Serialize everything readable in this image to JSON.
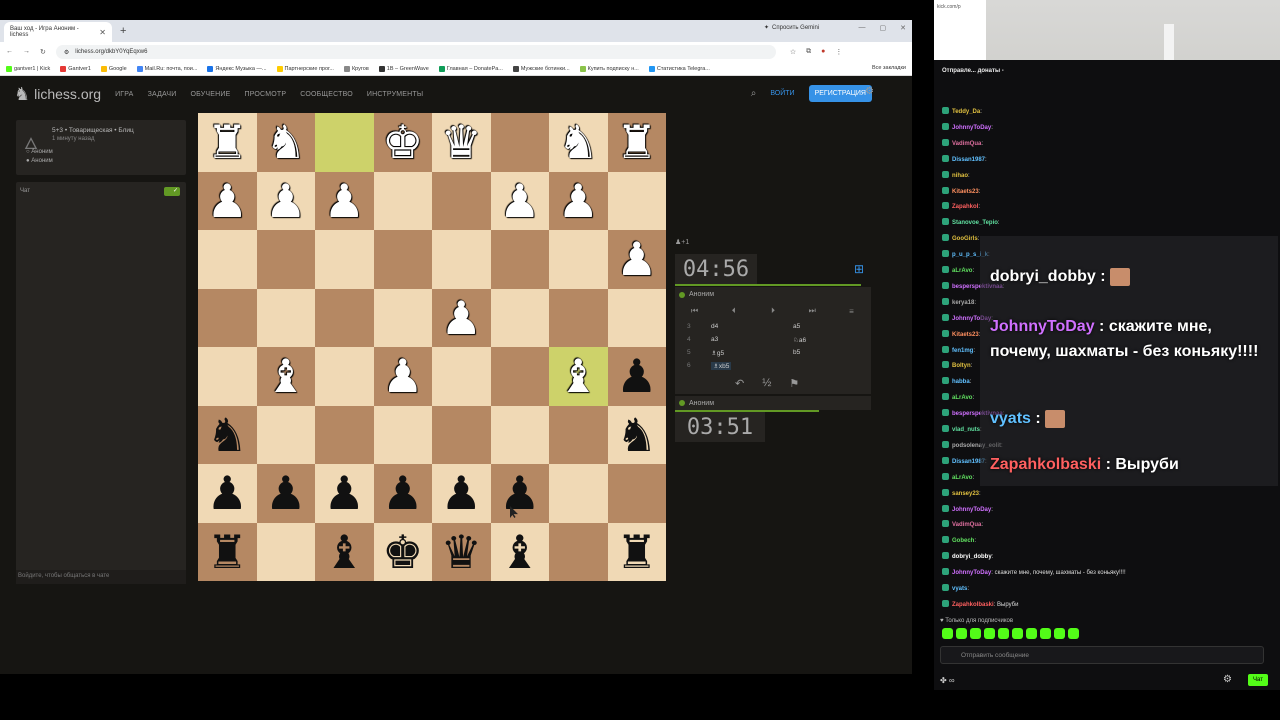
{
  "browser": {
    "tab_title": "Ваш ход - Игра Аноним - lichess",
    "gemini_label": "Спросить Gemini",
    "url": "lichess.org/dkbY0YqEqxw6",
    "bookmarks": [
      "gantver1 | Kick",
      "Gantver1",
      "Google",
      "Mail.Ru: почта, пои...",
      "Яндекс Музыка —...",
      "Партнерские прог...",
      "Кругов",
      "1B – GreenWave",
      "Главная – DonatePa...",
      "Мужские ботинки...",
      "Купить подписку н...",
      "Статистика Telegra..."
    ],
    "bookmarks_all": "Все закладки"
  },
  "lichess": {
    "logo": "lichess.org",
    "nav": [
      "ИГРА",
      "ЗАДАЧИ",
      "ОБУЧЕНИЕ",
      "ПРОСМОТР",
      "СООБЩЕСТВО",
      "ИНСТРУМЕНТЫ"
    ],
    "login": "ВОЙТИ",
    "register": "РЕГИСТРАЦИЯ"
  },
  "game": {
    "title": "5+3 • Товарищеская • Блиц",
    "time_ago": "1 минуту назад",
    "player1": "Аноним",
    "player2": "Аноним",
    "chat_label": "Чат",
    "chat_footer": "Войдите, чтобы общаться в чате"
  },
  "board": {
    "rows": [
      [
        "wR",
        "wN",
        "",
        "wK",
        "wQ",
        "",
        "wN",
        "wR"
      ],
      [
        "wP",
        "wP",
        "wP",
        "",
        "",
        "wP",
        "wP",
        ""
      ],
      [
        "",
        "",
        "",
        "",
        "",
        "",
        "",
        "wP"
      ],
      [
        "",
        "",
        "",
        "",
        "wP",
        "",
        "",
        ""
      ],
      [
        "",
        "wB",
        "",
        "wP",
        "",
        "",
        "wB",
        "bP"
      ],
      [
        "bN",
        "",
        "",
        "",
        "",
        "",
        "",
        "bN"
      ],
      [
        "bP",
        "bP",
        "bP",
        "bP",
        "bP",
        "bP",
        "",
        ""
      ],
      [
        "bR",
        "",
        "bB",
        "bK",
        "bQ",
        "bB",
        "",
        "bR"
      ]
    ],
    "highlights": [
      "0-2",
      "4-6"
    ]
  },
  "clock": {
    "provisional": "+1",
    "top_time": "04:56",
    "top_player": "Аноним",
    "bottom_time": "03:51",
    "bottom_player": "Аноним"
  },
  "moves": [
    {
      "num": "3",
      "white": "d4",
      "black": "a5"
    },
    {
      "num": "4",
      "white": "a3",
      "black": "♘a6"
    },
    {
      "num": "5",
      "white": "♗g5",
      "black": "b5"
    },
    {
      "num": "6",
      "white": "♗xb5",
      "black": ""
    }
  ],
  "stream_chat": {
    "lines": [
      {
        "name": "Teddy_Da",
        "text": "",
        "color": "#e0c040"
      },
      {
        "name": "JohnnyToDay",
        "text": "",
        "color": "#d070ff"
      },
      {
        "name": "VadimQua",
        "text": "",
        "color": "#e070a0"
      },
      {
        "name": "Dissan1987",
        "text": "",
        "color": "#60c0ff"
      },
      {
        "name": "nihao",
        "text": "",
        "color": "#e0c040"
      },
      {
        "name": "Kitaets23",
        "text": "",
        "color": "#ff9060"
      },
      {
        "name": "Zapahkol",
        "text": "",
        "color": "#ff6060"
      },
      {
        "name": "Stanovoe_Tepio",
        "text": "",
        "color": "#60e0a0"
      },
      {
        "name": "GooGirls",
        "text": "",
        "color": "#e0c040"
      },
      {
        "name": "p_u_p_s_i_k",
        "text": "",
        "color": "#60c0ff"
      },
      {
        "name": "aLrAvo",
        "text": "",
        "color": "#60e060"
      },
      {
        "name": "besperspektivnaa",
        "text": "",
        "color": "#d070ff"
      },
      {
        "name": "kerya18",
        "text": "",
        "color": "#aaaaaa"
      },
      {
        "name": "JohnnyToDay",
        "text": "",
        "color": "#d070ff"
      },
      {
        "name": "Kitaets23",
        "text": "",
        "color": "#ff9060"
      },
      {
        "name": "fen1mg",
        "text": "",
        "color": "#60c0ff"
      },
      {
        "name": "Boltyn",
        "text": "",
        "color": "#e0c040"
      },
      {
        "name": "habba",
        "text": "",
        "color": "#60c0ff"
      },
      {
        "name": "aLrAvo",
        "text": "",
        "color": "#60e060"
      },
      {
        "name": "besperspektivnaa",
        "text": "",
        "color": "#d070ff"
      },
      {
        "name": "vlad_nuts",
        "text": "",
        "color": "#60e0a0"
      },
      {
        "name": "podsolenay_eolit",
        "text": "",
        "color": "#aaaaaa"
      },
      {
        "name": "Dissan1987",
        "text": "",
        "color": "#60c0ff"
      },
      {
        "name": "aLrAvo",
        "text": "",
        "color": "#60e060"
      },
      {
        "name": "sansey23",
        "text": "",
        "color": "#e0c040"
      },
      {
        "name": "JohnnyToDay",
        "text": "",
        "color": "#d070ff"
      },
      {
        "name": "VadimQua",
        "text": "",
        "color": "#e070a0"
      },
      {
        "name": "Gobech",
        "text": "",
        "color": "#60e060"
      },
      {
        "name": "dobryi_dobby",
        "text": "",
        "color": "#ffffff"
      },
      {
        "name": "JohnnyToDay",
        "text": "скажите мне, почему, шахматы - без коньяку!!!!",
        "color": "#d070ff"
      },
      {
        "name": "vyats",
        "text": "",
        "color": "#60c0ff"
      },
      {
        "name": "Zapahkolbaski",
        "text": "Выруби",
        "color": "#ff6060"
      }
    ],
    "popup": [
      {
        "name": "dobryi_dobby",
        "text": "",
        "color": "#ffffff"
      },
      {
        "name": "JohnnyToDay",
        "text": "скажите мне, почему, шахматы - без коньяку!!!!",
        "color": "#d070ff"
      },
      {
        "name": "vyats",
        "text": "",
        "color": "#60c0ff"
      },
      {
        "name": "Zapahkolbaski",
        "text": "Выруби",
        "color": "#ff6060"
      }
    ],
    "subs_only": "Только для подписчиков",
    "input_placeholder": "Отправить сообщение",
    "send_label": "Чат",
    "top_notice": "Отправле... донаты -",
    "side_url": "kick.com/p"
  }
}
